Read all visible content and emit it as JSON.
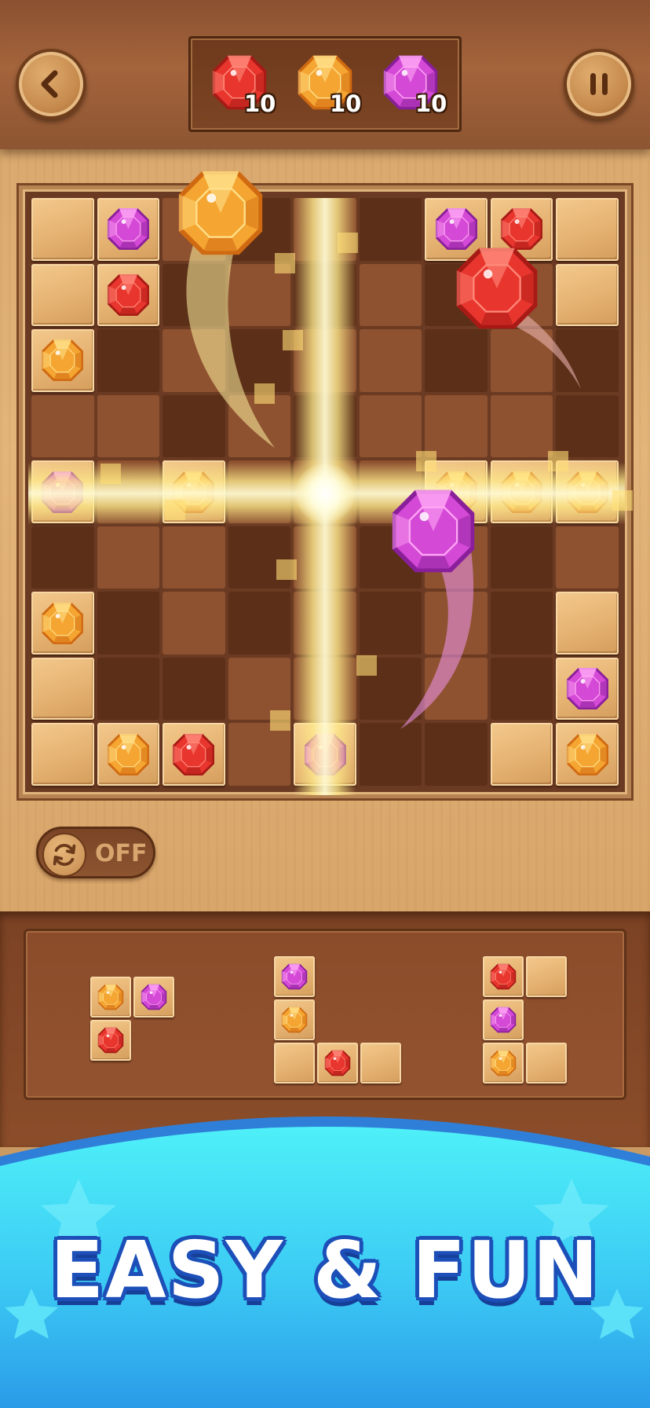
{
  "colors": {
    "red_gem": "#e8362e",
    "orange_gem": "#f5a531",
    "purple_gem": "#d44ad6",
    "banner_sky": "#3ad4f6",
    "banner_text_outline": "#1d4fb8"
  },
  "header": {
    "back_icon": "chevron-left-icon",
    "pause_icon": "pause-icon",
    "goals": [
      {
        "gem": "red",
        "count": "10"
      },
      {
        "gem": "orange",
        "count": "10"
      },
      {
        "gem": "purple",
        "count": "10"
      }
    ]
  },
  "board": {
    "size": 9,
    "rows": [
      [
        "W",
        "P",
        "L",
        "D",
        "L",
        "D",
        "P",
        "R",
        "W"
      ],
      [
        "W",
        "R",
        "D",
        "L",
        "D",
        "L",
        "D",
        "L",
        "W"
      ],
      [
        "O",
        "D",
        "L",
        "D",
        "L",
        "L",
        "D",
        "L",
        "D"
      ],
      [
        "L",
        "L",
        "D",
        "L",
        "D",
        "L",
        "L",
        "L",
        "D"
      ],
      [
        "P",
        "L",
        "O",
        "L",
        "L",
        "L",
        "O",
        "O",
        "O"
      ],
      [
        "D",
        "L",
        "L",
        "D",
        "L",
        "D",
        "L",
        "D",
        "L"
      ],
      [
        "O",
        "D",
        "L",
        "D",
        "L",
        "D",
        "L",
        "D",
        "W"
      ],
      [
        "W",
        "D",
        "D",
        "L",
        "L",
        "D",
        "L",
        "D",
        "P"
      ],
      [
        "W",
        "O",
        "R",
        "L",
        "P",
        "D",
        "D",
        "W",
        "O"
      ]
    ],
    "flying_gems": [
      "orange",
      "red",
      "purple"
    ]
  },
  "auto_toggle": {
    "icon": "refresh-icon",
    "state": "OFF"
  },
  "tray": {
    "pieces": [
      {
        "cells": [
          {
            "r": 0,
            "c": 0,
            "gem": "orange"
          },
          {
            "r": 0,
            "c": 1,
            "gem": "purple"
          },
          {
            "r": 1,
            "c": 0,
            "gem": "red"
          }
        ]
      },
      {
        "cells": [
          {
            "r": 0,
            "c": 0,
            "gem": "purple"
          },
          {
            "r": 1,
            "c": 0,
            "gem": "orange"
          },
          {
            "r": 2,
            "c": 0,
            "gem": ""
          },
          {
            "r": 2,
            "c": 1,
            "gem": "red"
          },
          {
            "r": 2,
            "c": 2,
            "gem": ""
          }
        ]
      },
      {
        "cells": [
          {
            "r": 0,
            "c": 0,
            "gem": "red"
          },
          {
            "r": 0,
            "c": 1,
            "gem": ""
          },
          {
            "r": 1,
            "c": 0,
            "gem": "purple"
          },
          {
            "r": 2,
            "c": 0,
            "gem": "orange"
          },
          {
            "r": 2,
            "c": 1,
            "gem": ""
          }
        ]
      }
    ]
  },
  "banner": {
    "text": "EASY & FUN"
  }
}
